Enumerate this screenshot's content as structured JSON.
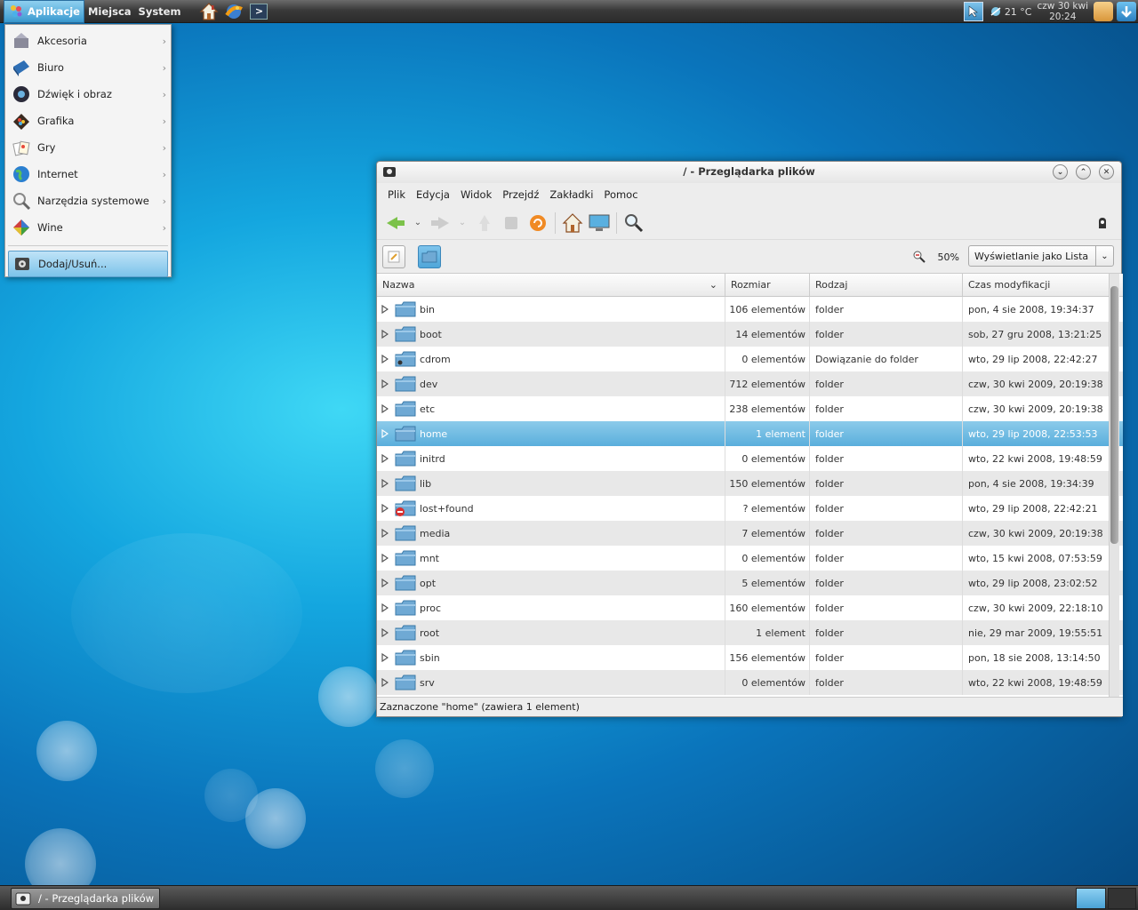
{
  "top_panel": {
    "menus": [
      "Aplikacje",
      "Miejsca",
      "System"
    ],
    "launchers": [
      "home-icon",
      "web-browser-icon",
      "terminal-icon"
    ],
    "weather": "21 °C",
    "clock_date": "czw 30 kwi",
    "clock_time": "20:24"
  },
  "apps_menu": {
    "items": [
      {
        "label": "Akcesoria",
        "icon": "accessories-icon"
      },
      {
        "label": "Biuro",
        "icon": "office-icon"
      },
      {
        "label": "Dźwięk i obraz",
        "icon": "multimedia-icon"
      },
      {
        "label": "Grafika",
        "icon": "graphics-icon"
      },
      {
        "label": "Gry",
        "icon": "games-icon"
      },
      {
        "label": "Internet",
        "icon": "internet-icon"
      },
      {
        "label": "Narzędzia systemowe",
        "icon": "system-tools-icon"
      },
      {
        "label": "Wine",
        "icon": "wine-icon"
      }
    ],
    "bottom_item": "Dodaj/Usuń..."
  },
  "window": {
    "title": "/ - Przeglądarka plików",
    "menubar": [
      "Plik",
      "Edycja",
      "Widok",
      "Przejdź",
      "Zakładki",
      "Pomoc"
    ],
    "zoom": "50%",
    "view_mode": "Wyświetlanie jako Lista",
    "columns": [
      "Nazwa",
      "Rozmiar",
      "Rodzaj",
      "Czas modyfikacji"
    ],
    "rows": [
      {
        "name": "bin",
        "size": "106 elementów",
        "type": "folder",
        "date": "pon, 4 sie 2008, 19:34:37"
      },
      {
        "name": "boot",
        "size": "14 elementów",
        "type": "folder",
        "date": "sob, 27 gru 2008, 13:21:25"
      },
      {
        "name": "cdrom",
        "size": "0 elementów",
        "type": "Dowiązanie do folder",
        "date": "wto, 29 lip 2008, 22:42:27"
      },
      {
        "name": "dev",
        "size": "712 elementów",
        "type": "folder",
        "date": "czw, 30 kwi 2009, 20:19:38"
      },
      {
        "name": "etc",
        "size": "238 elementów",
        "type": "folder",
        "date": "czw, 30 kwi 2009, 20:19:38"
      },
      {
        "name": "home",
        "size": "1 element",
        "type": "folder",
        "date": "wto, 29 lip 2008, 22:53:53"
      },
      {
        "name": "initrd",
        "size": "0 elementów",
        "type": "folder",
        "date": "wto, 22 kwi 2008, 19:48:59"
      },
      {
        "name": "lib",
        "size": "150 elementów",
        "type": "folder",
        "date": "pon, 4 sie 2008, 19:34:39"
      },
      {
        "name": "lost+found",
        "size": "? elementów",
        "type": "folder",
        "date": "wto, 29 lip 2008, 22:42:21"
      },
      {
        "name": "media",
        "size": "7 elementów",
        "type": "folder",
        "date": "czw, 30 kwi 2009, 20:19:38"
      },
      {
        "name": "mnt",
        "size": "0 elementów",
        "type": "folder",
        "date": "wto, 15 kwi 2008, 07:53:59"
      },
      {
        "name": "opt",
        "size": "5 elementów",
        "type": "folder",
        "date": "wto, 29 lip 2008, 23:02:52"
      },
      {
        "name": "proc",
        "size": "160 elementów",
        "type": "folder",
        "date": "czw, 30 kwi 2009, 22:18:10"
      },
      {
        "name": "root",
        "size": "1 element",
        "type": "folder",
        "date": "nie, 29 mar 2009, 19:55:51"
      },
      {
        "name": "sbin",
        "size": "156 elementów",
        "type": "folder",
        "date": "pon, 18 sie 2008, 13:14:50"
      },
      {
        "name": "srv",
        "size": "0 elementów",
        "type": "folder",
        "date": "wto, 22 kwi 2008, 19:48:59"
      }
    ],
    "status": "Zaznaczone \"home\" (zawiera 1 element)"
  },
  "bottom_panel": {
    "task_label": "/ - Przeglądarka plików"
  },
  "colors": {
    "selection": "#5aaedc",
    "folder": "#6fa9d4"
  }
}
